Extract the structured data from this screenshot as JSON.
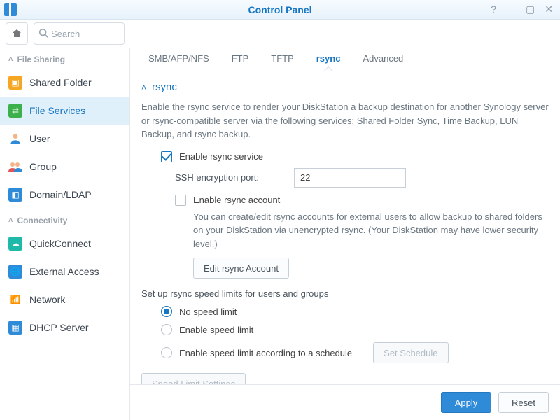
{
  "window": {
    "title": "Control Panel"
  },
  "search": {
    "placeholder": "Search"
  },
  "sidebar": {
    "groups": [
      {
        "label": "File Sharing"
      },
      {
        "label": "Connectivity"
      }
    ],
    "items": {
      "shared_folder": "Shared Folder",
      "file_services": "File Services",
      "user": "User",
      "group": "Group",
      "domain_ldap": "Domain/LDAP",
      "quickconnect": "QuickConnect",
      "external_access": "External Access",
      "network": "Network",
      "dhcp_server": "DHCP Server"
    }
  },
  "tabs": {
    "smb": "SMB/AFP/NFS",
    "ftp": "FTP",
    "tftp": "TFTP",
    "rsync": "rsync",
    "advanced": "Advanced"
  },
  "section": {
    "title": "rsync",
    "description": "Enable the rsync service to render your DiskStation a backup destination for another Synology server or rsync-compatible server via the following services: Shared Folder Sync, Time Backup, LUN Backup, and rsync backup.",
    "enable_service": "Enable rsync service",
    "ssh_port_label": "SSH encryption port:",
    "ssh_port_value": "22",
    "enable_account": "Enable rsync account",
    "account_note": "You can create/edit rsync accounts for external users to allow backup to shared folders on your DiskStation via unencrypted rsync. (Your DiskStation may have lower security level.)",
    "edit_account_btn": "Edit rsync Account",
    "speed_intro": "Set up rsync speed limits for users and groups",
    "radio_no_limit": "No speed limit",
    "radio_enable_limit": "Enable speed limit",
    "radio_schedule": "Enable speed limit according to a schedule",
    "set_schedule_btn": "Set Schedule",
    "speed_settings_btn": "Speed Limit Settings"
  },
  "footer": {
    "apply": "Apply",
    "reset": "Reset"
  }
}
